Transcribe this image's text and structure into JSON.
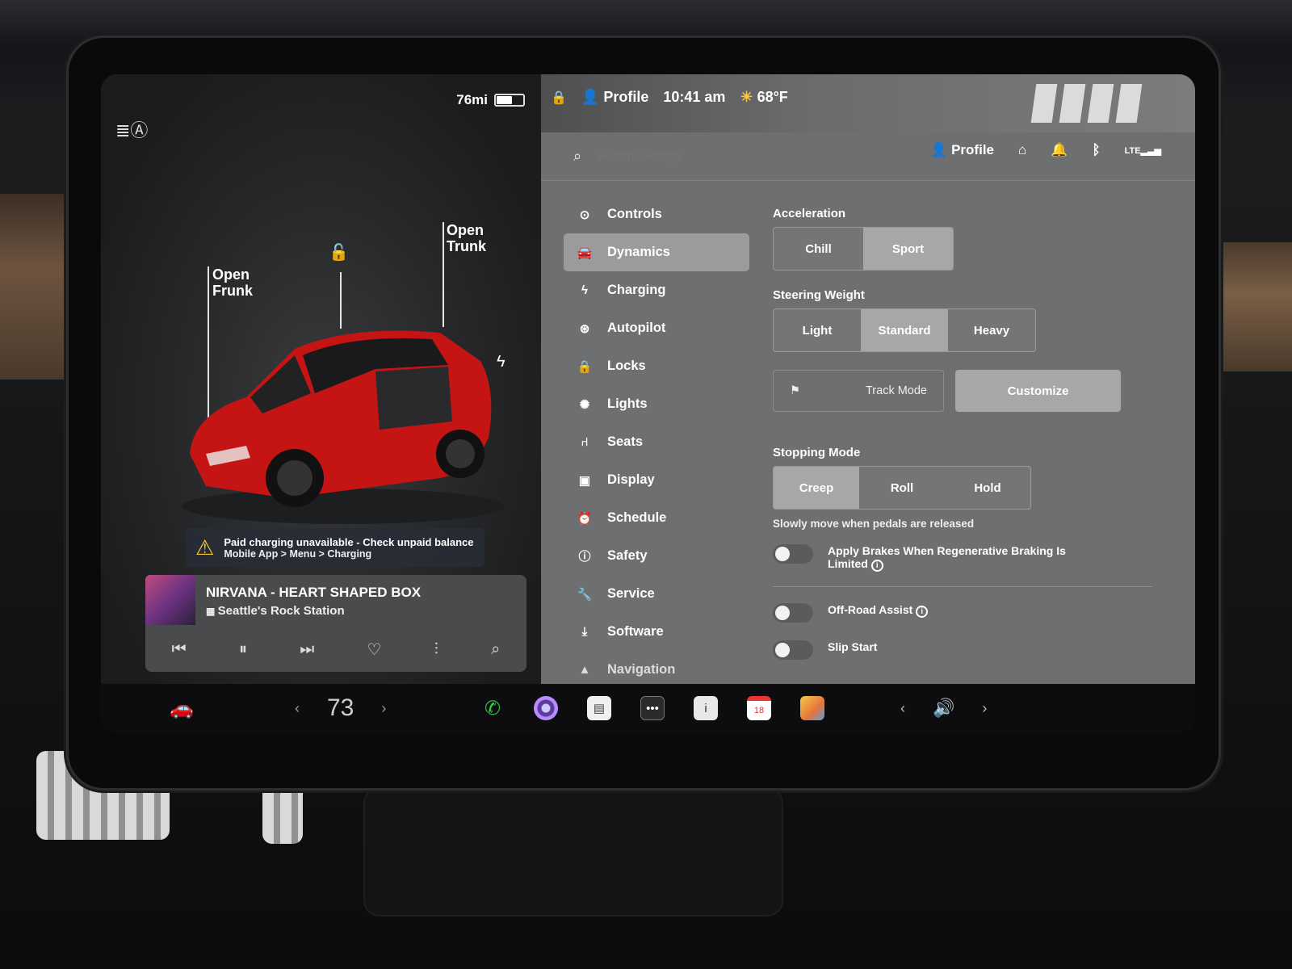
{
  "car_panel": {
    "range": "76mi",
    "battery_level": 0.55,
    "open_frunk": "Open\nFrunk",
    "open_trunk": "Open\nTrunk",
    "warning_line1": "Paid charging unavailable - Check unpaid balance",
    "warning_line2": "Mobile App > Menu > Charging"
  },
  "media": {
    "title": "NIRVANA - HEART SHAPED BOX",
    "station": "Seattle's Rock Station"
  },
  "status": {
    "profile": "Profile",
    "time": "10:41 am",
    "temperature": "68°F"
  },
  "search": {
    "placeholder": "Search Settings"
  },
  "header": {
    "profile": "Profile"
  },
  "nav": {
    "items": [
      {
        "label": "Controls"
      },
      {
        "label": "Dynamics"
      },
      {
        "label": "Charging"
      },
      {
        "label": "Autopilot"
      },
      {
        "label": "Locks"
      },
      {
        "label": "Lights"
      },
      {
        "label": "Seats"
      },
      {
        "label": "Display"
      },
      {
        "label": "Schedule"
      },
      {
        "label": "Safety"
      },
      {
        "label": "Service"
      },
      {
        "label": "Software"
      },
      {
        "label": "Navigation"
      }
    ]
  },
  "dynamics": {
    "acceleration": {
      "label": "Acceleration",
      "options": [
        "Chill",
        "Sport"
      ],
      "selected": "Sport"
    },
    "steering": {
      "label": "Steering Weight",
      "options": [
        "Light",
        "Standard",
        "Heavy"
      ],
      "selected": "Standard"
    },
    "track_mode": "Track Mode",
    "customize": "Customize",
    "stopping": {
      "label": "Stopping Mode",
      "options": [
        "Creep",
        "Roll",
        "Hold"
      ],
      "selected": "Creep",
      "hint": "Slowly move when pedals are released"
    },
    "apply_brakes": "Apply Brakes When Regenerative Braking Is Limited",
    "off_road": "Off-Road Assist",
    "slip_start": "Slip Start"
  },
  "dock": {
    "temperature": "73",
    "calendar_day": "18"
  }
}
